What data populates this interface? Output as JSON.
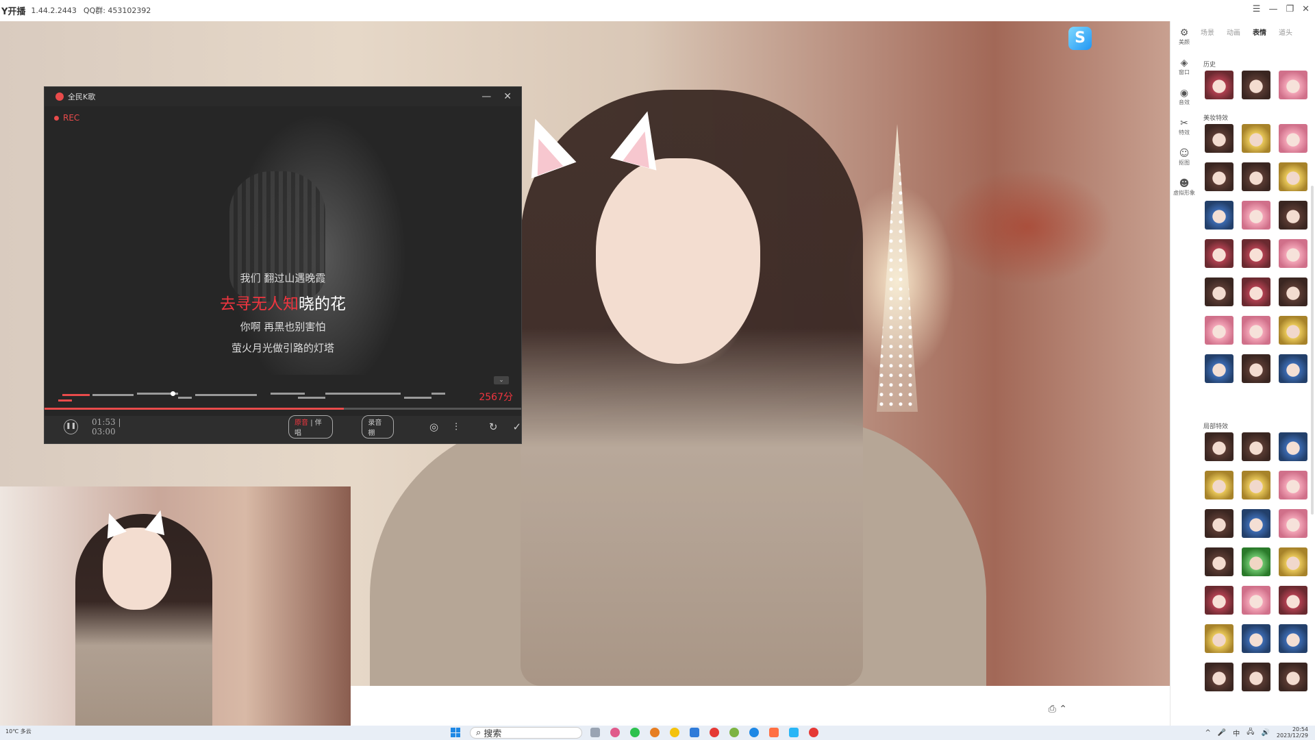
{
  "titlebar": {
    "app_name": "Y开播",
    "version": "1.44.2.2443",
    "qq": "QQ群: 453102392",
    "controls": [
      "☰",
      "—",
      "❐",
      "✕"
    ]
  },
  "karaoke": {
    "title": "全民K歌",
    "minimize": "—",
    "close": "✕",
    "rec_label": "REC",
    "lyrics": {
      "prev": "我们 翻过山遇晚霞",
      "current_sung": "去寻无人知",
      "current_rest": "晓的花",
      "next1": "你啊 再黑也别害怕",
      "next2": "萤火月光做引路的灯塔"
    },
    "score": "2567分",
    "time": "01:53 | 03:00",
    "progress": 0.628,
    "vocal_toggle": {
      "on": "原音",
      "sep": " | ",
      "off": "伴唱"
    },
    "sound_effect": "录音棚",
    "chevron": "⌄"
  },
  "right_panel": {
    "tools": [
      {
        "icon": "⚙",
        "label": "美颜"
      },
      {
        "icon": "◈",
        "label": "窗口"
      },
      {
        "icon": "◉",
        "label": "音效"
      },
      {
        "icon": "✂",
        "label": "特效"
      },
      {
        "icon": "☺",
        "label": "抠图"
      },
      {
        "icon": "☻",
        "label": "虚拟形象"
      }
    ],
    "tabs": [
      "场景",
      "动画",
      "表情",
      "道头"
    ],
    "active_tab": "表情",
    "sections": {
      "history": "历史",
      "beauty": "美妆特效",
      "local": "局部特效"
    }
  },
  "taskbar": {
    "weather": "10℃ 多云",
    "search": "搜索",
    "time": "20:54",
    "date": "2023/12/29",
    "tray": [
      "^",
      "🎤",
      "中",
      "🖧",
      "🔊"
    ]
  },
  "colors": {
    "accent_red": "#f0353f",
    "taskbar_bg": "#e8eef6"
  }
}
